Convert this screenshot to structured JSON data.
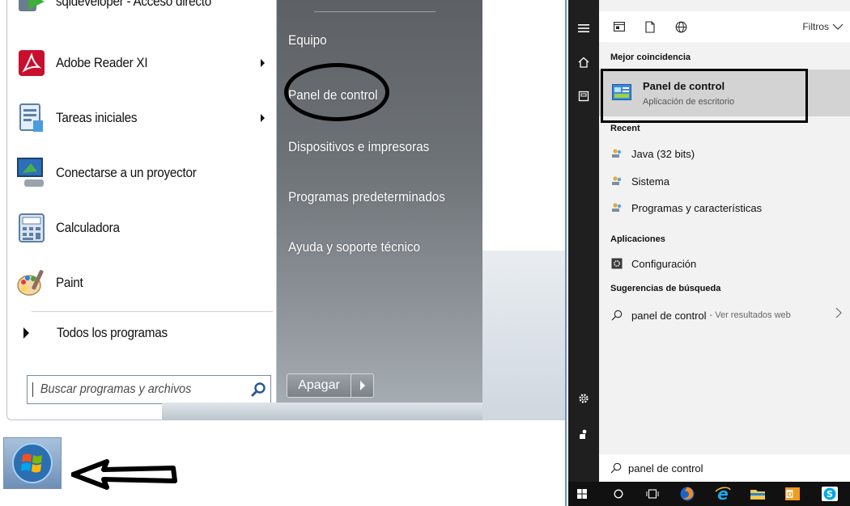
{
  "win7": {
    "programs": [
      {
        "label": "sqldeveloper - Acceso directo",
        "icon": "sqldeveloper-icon",
        "submenu": false
      },
      {
        "label": "Adobe Reader XI",
        "icon": "adobe-reader-icon",
        "submenu": true
      },
      {
        "label": "Tareas iniciales",
        "icon": "getting-started-icon",
        "submenu": true
      },
      {
        "label": "Conectarse a un proyector",
        "icon": "projector-icon",
        "submenu": false
      },
      {
        "label": "Calculadora",
        "icon": "calculator-icon",
        "submenu": false
      },
      {
        "label": "Paint",
        "icon": "paint-icon",
        "submenu": false
      }
    ],
    "all_programs": "Todos los programas",
    "search_placeholder": "Buscar programas y archivos",
    "right_items": [
      "Equipo",
      "Panel de control",
      "Dispositivos e impresoras",
      "Programas predeterminados",
      "Ayuda y soporte técnico"
    ],
    "shutdown_label": "Apagar"
  },
  "win10": {
    "filters_label": "Filtros",
    "best_match_header": "Mejor coincidencia",
    "best_match": {
      "title": "Panel de control",
      "subtitle": "Aplicación de escritorio"
    },
    "recent_header": "Recent",
    "recent": [
      "Java (32 bits)",
      "Sistema",
      "Programas y características"
    ],
    "apps_header": "Aplicaciones",
    "apps": [
      "Configuración"
    ],
    "suggestions_header": "Sugerencias de búsqueda",
    "suggestion": {
      "query": "panel de control",
      "hint": "- Ver resultados web"
    },
    "search_value": "panel de control"
  },
  "colors": {
    "win10_rail": "#1f1f1f",
    "win10_taskbar": "#111111",
    "win10_highlight": "#d3d3d3",
    "annotation": "#000000"
  }
}
